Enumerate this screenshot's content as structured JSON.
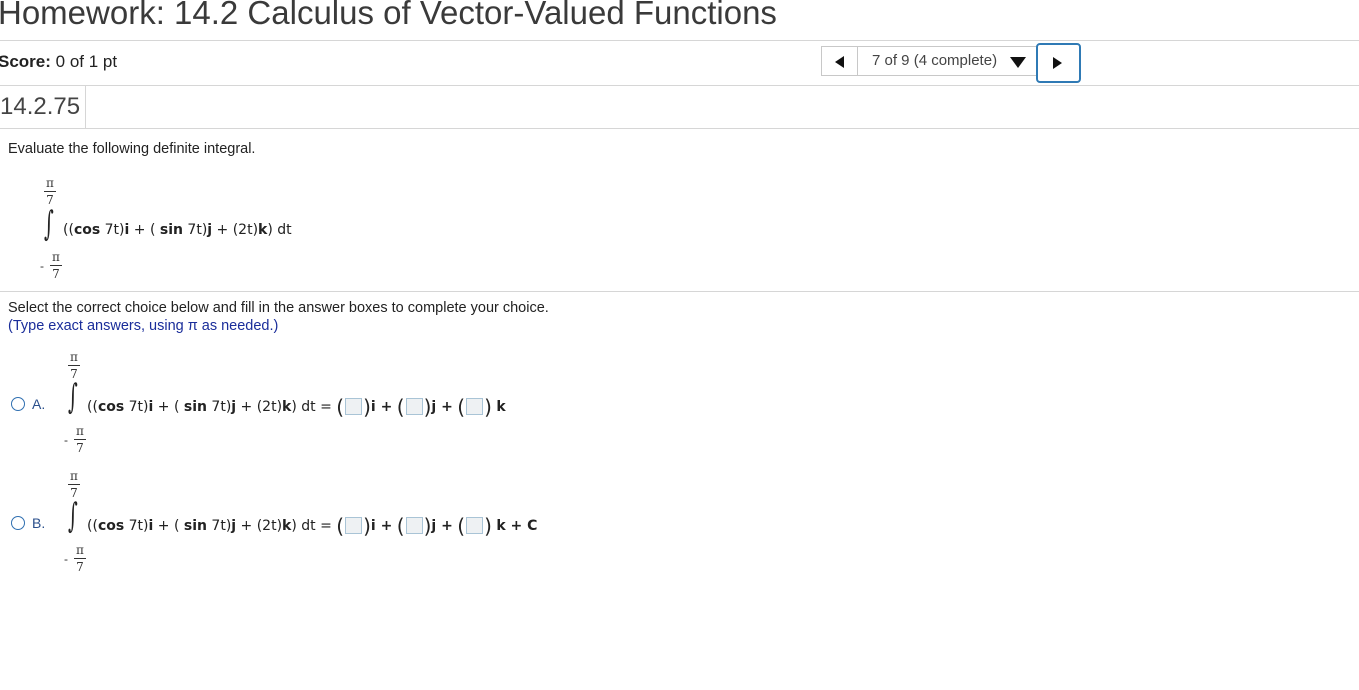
{
  "header": {
    "title": "Homework: 14.2 Calculus of Vector-Valued Functions"
  },
  "score": {
    "label": "Score:",
    "value": "0 of 1 pt"
  },
  "nav": {
    "prev_icon": "triangle-left-icon",
    "position": "7 of 9 (4 complete)",
    "dropdown_icon": "triangle-down-icon",
    "next_icon": "triangle-right-icon"
  },
  "question": {
    "number": "14.2.75",
    "prompt": "Evaluate the following definite integral.",
    "upper_num": "π",
    "upper_den": "7",
    "lower_neg": "-",
    "lower_num": "π",
    "lower_den": "7",
    "integral_sign": "∫",
    "integrand_html": "((<b>cos</b> 7t)<b>i</b> + ( <b>sin</b> 7t)<b>j</b> + (2t)<b>k</b>) dt",
    "instruction": "Select the correct choice below and fill in the answer boxes to complete your choice.",
    "hint": "(Type exact answers, using π as needed.)"
  },
  "options": [
    {
      "label": "A.",
      "eq": "= ",
      "i": "i +",
      "j": "j +",
      "k": "k",
      "tail": ""
    },
    {
      "label": "B.",
      "eq": "= ",
      "i": "i +",
      "j": "j +",
      "k": "k + C",
      "tail": ""
    }
  ]
}
